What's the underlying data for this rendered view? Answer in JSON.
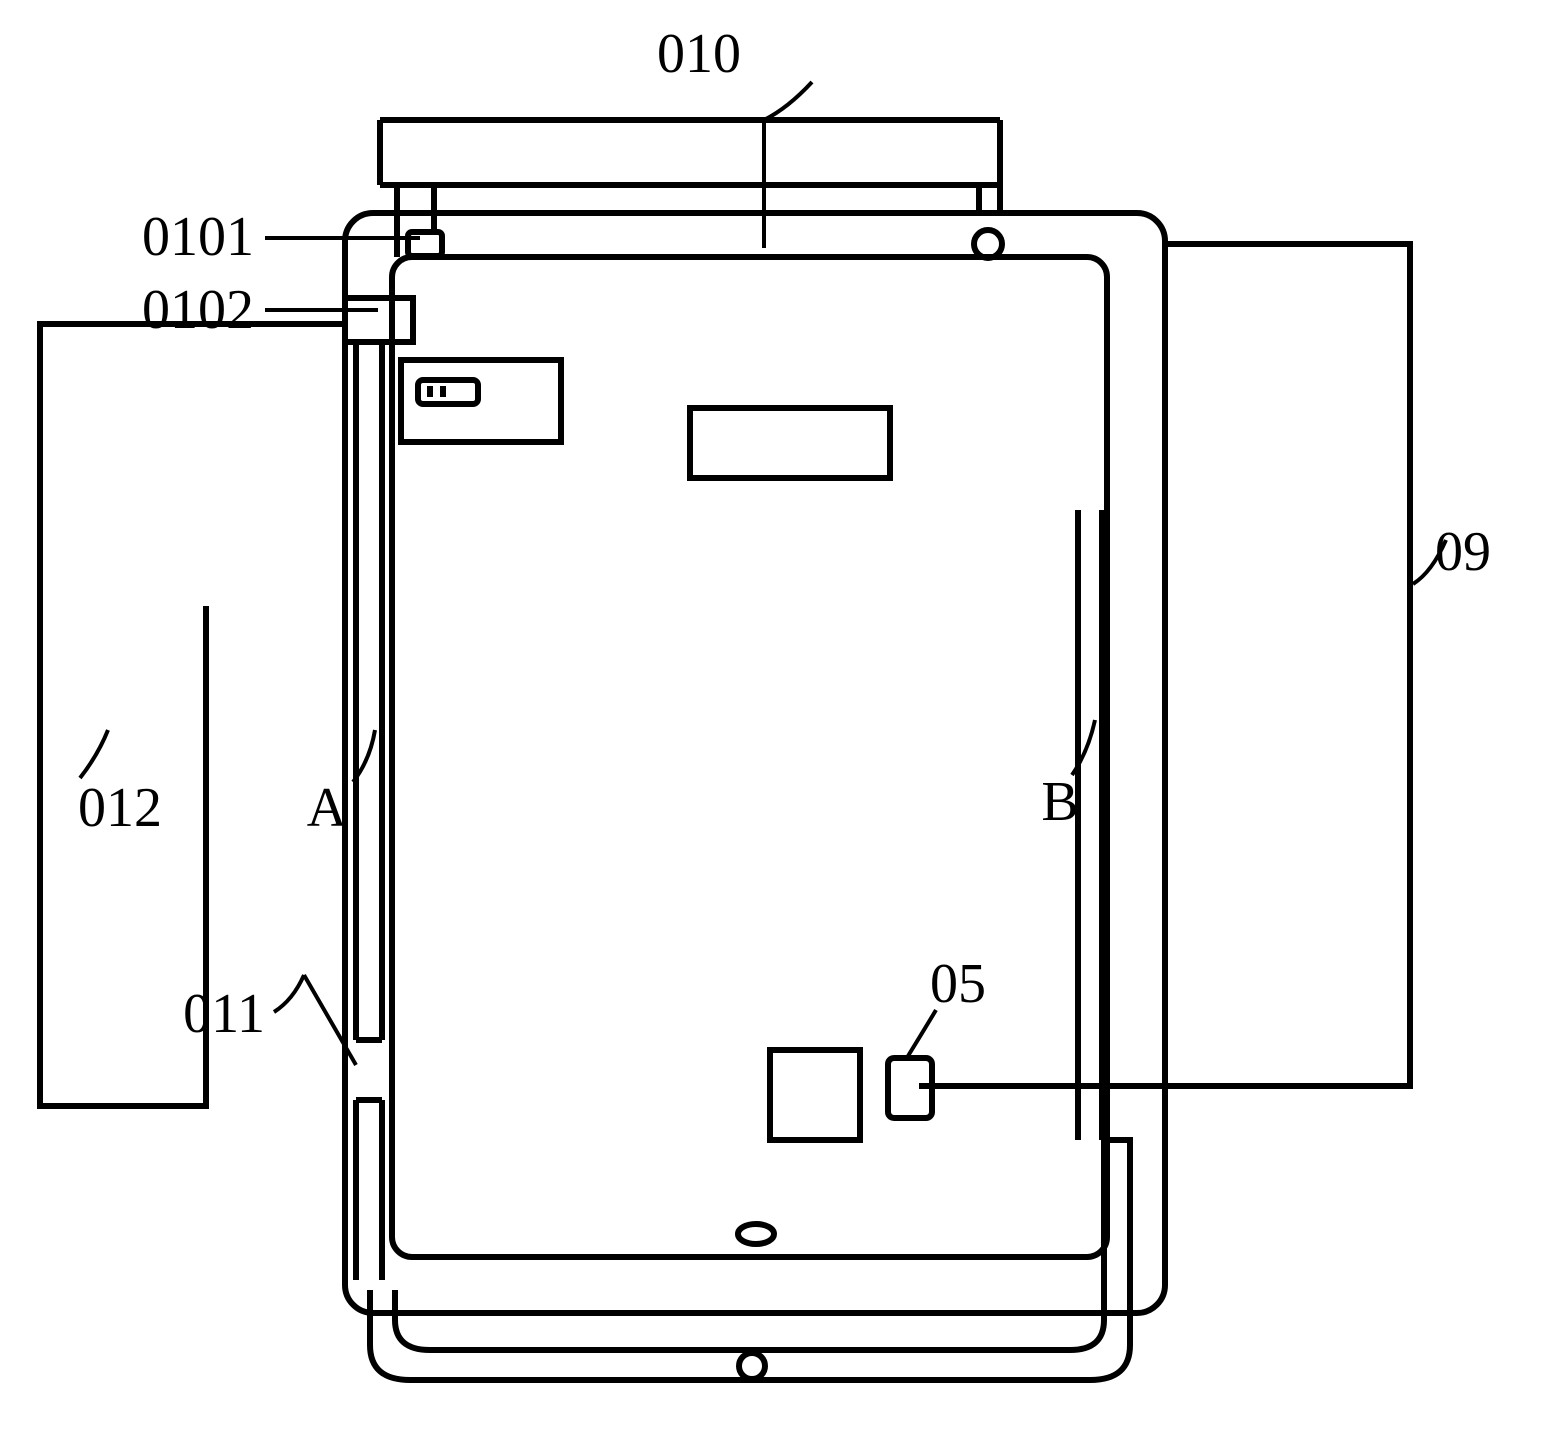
{
  "labels": {
    "top": "010",
    "upper1": "0101",
    "upper2": "0102",
    "left": "012",
    "lowerleft": "011",
    "right": "09",
    "A": "A",
    "B": "B",
    "center": "05"
  }
}
